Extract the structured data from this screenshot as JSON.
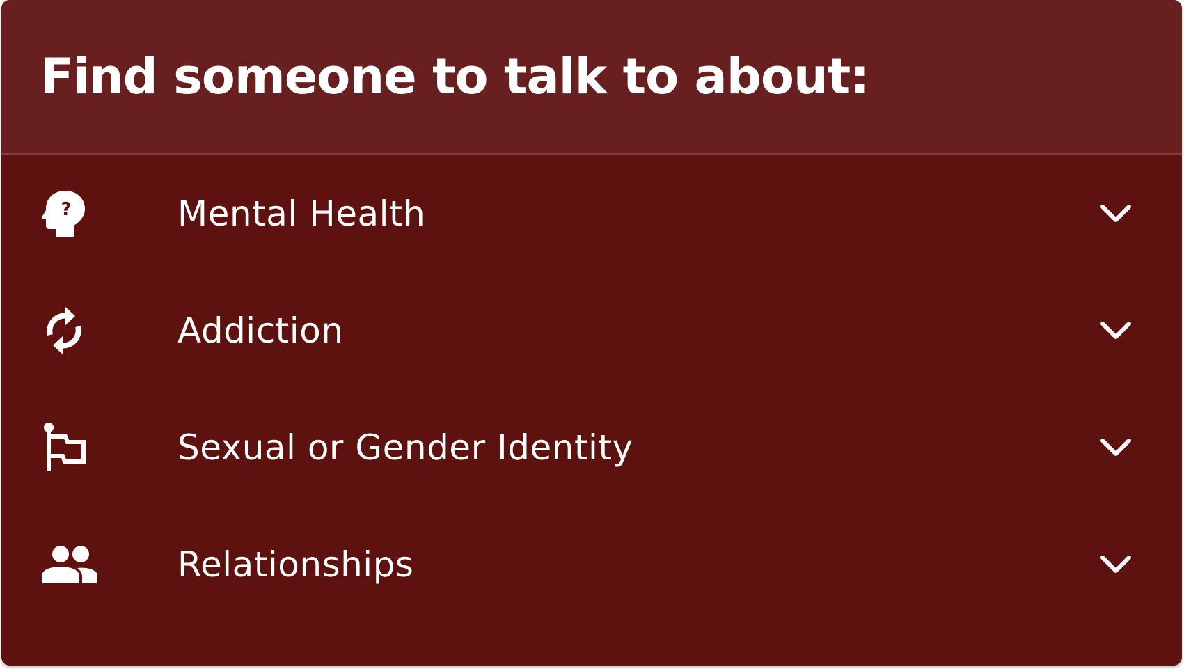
{
  "card": {
    "title": "Find someone to talk to about:",
    "colors": {
      "header_bg": "#681f1f",
      "body_bg": "#5e1210",
      "text": "#ffffff"
    }
  },
  "items": [
    {
      "label": "Mental Health",
      "icon": "head-question-icon",
      "expanded": false
    },
    {
      "label": "Addiction",
      "icon": "cycle-arrows-icon",
      "expanded": false
    },
    {
      "label": "Sexual or Gender Identity",
      "icon": "flag-icon",
      "expanded": false
    },
    {
      "label": "Relationships",
      "icon": "people-icon",
      "expanded": false
    }
  ]
}
